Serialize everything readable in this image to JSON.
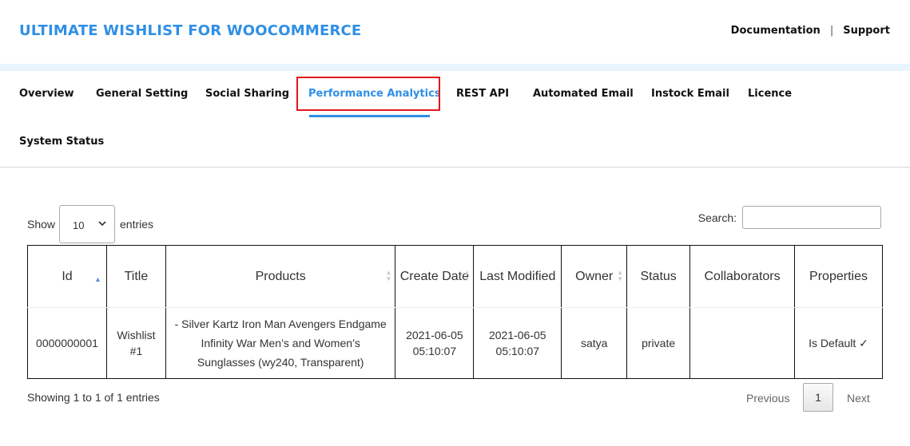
{
  "header": {
    "title": "ULTIMATE WISHLIST FOR WOOCOMMERCE",
    "links": [
      "Documentation",
      "Support"
    ],
    "separator": "|"
  },
  "tabs": [
    {
      "label": "Overview"
    },
    {
      "label": "General Setting"
    },
    {
      "label": "Social Sharing"
    },
    {
      "label": "Performance Analytics",
      "active": true
    },
    {
      "label": "REST API"
    },
    {
      "label": "Automated Email"
    },
    {
      "label": "Instock Email"
    },
    {
      "label": "Licence"
    },
    {
      "label": "System Status"
    }
  ],
  "colors": {
    "accent": "#2f8fe6",
    "highlight_border": "#e0161d"
  },
  "table_controls": {
    "show_label": "Show",
    "page_length": "10",
    "entries_label": "entries",
    "search_label": "Search:",
    "search_value": ""
  },
  "table": {
    "columns": [
      "Id",
      "Title",
      "Products",
      "Create Date",
      "Last Modified",
      "Owner",
      "Status",
      "Collaborators",
      "Properties"
    ],
    "rows": [
      {
        "id": "0000000001",
        "title": "Wishlist #1",
        "products": "- Silver Kartz Iron Man Avengers Endgame Infinity War Men’s and Women’s Sunglasses (wy240, Transparent)",
        "create_date": "2021-06-05 05:10:07",
        "last_modified": "2021-06-05 05:10:07",
        "owner": "satya",
        "status": "private",
        "collaborators": "",
        "properties": "Is Default ✓"
      }
    ]
  },
  "footer": {
    "info": "Showing 1 to 1 of 1 entries",
    "previous": "Previous",
    "current_page": "1",
    "next": "Next"
  }
}
